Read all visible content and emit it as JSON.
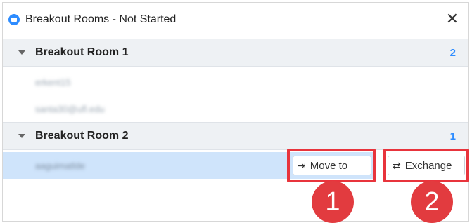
{
  "window": {
    "title": "Breakout Rooms - Not Started",
    "close_glyph": "✕"
  },
  "rooms": [
    {
      "name": "Breakout Room 1",
      "count": "2",
      "members": [
        "erkent15",
        "santa30@ufl.edu"
      ]
    },
    {
      "name": "Breakout Room 2",
      "count": "1",
      "members": [
        "aaguimatlde"
      ]
    }
  ],
  "actions": {
    "move_to_label": "Move to",
    "move_to_icon": "⇥",
    "exchange_label": "Exchange",
    "exchange_icon": "⇄"
  },
  "callouts": [
    "1",
    "2"
  ],
  "colors": {
    "accent": "#2d8cff",
    "highlight": "#e8343c",
    "selected_row": "#cfe4fb"
  }
}
